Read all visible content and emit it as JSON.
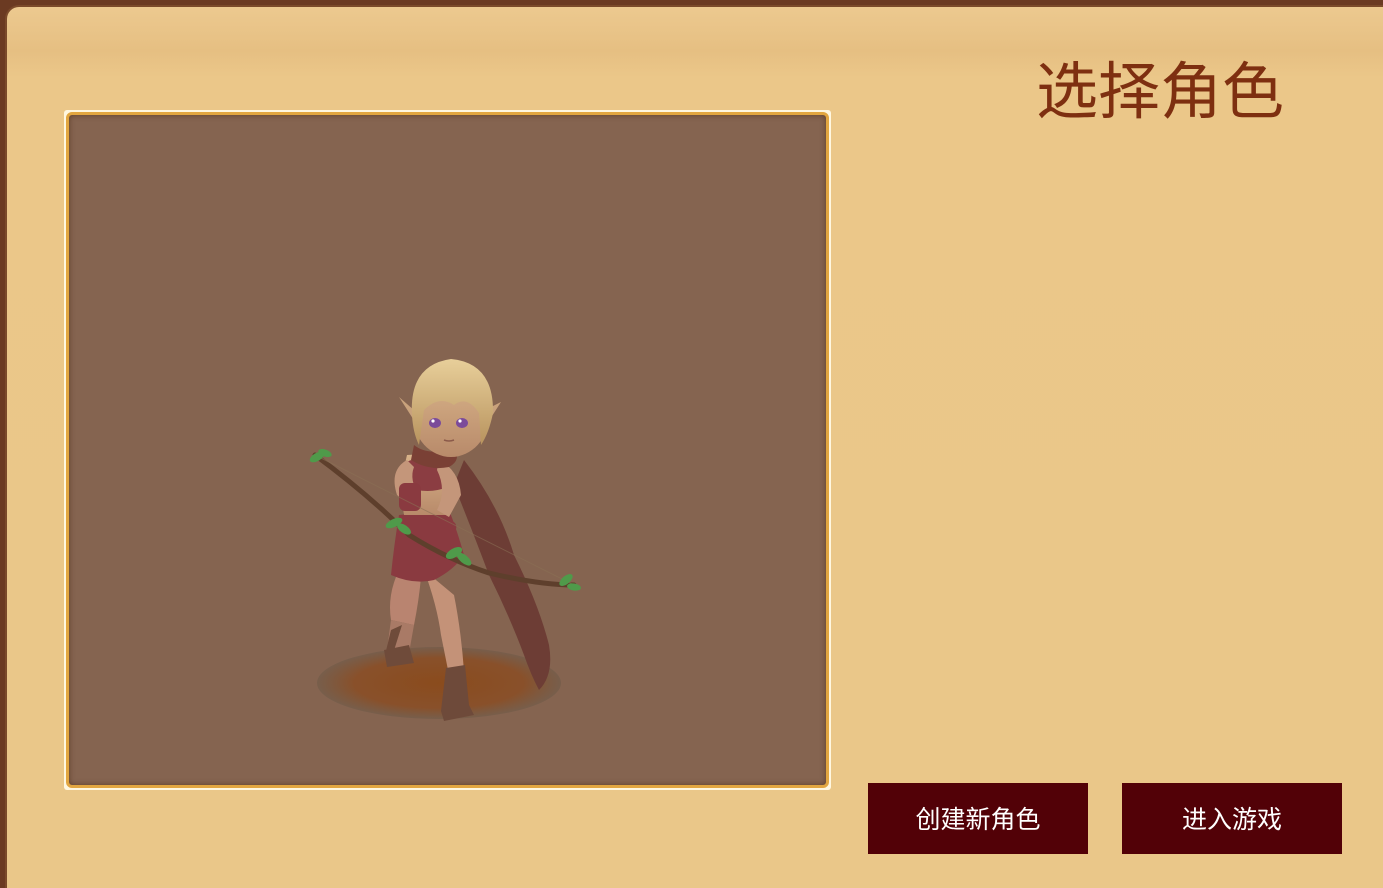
{
  "screen": {
    "title": "选择角色"
  },
  "character_preview": {
    "character": "elf-archer-character"
  },
  "actions": {
    "create_label": "创建新角色",
    "enter_label": "进入游戏"
  },
  "colors": {
    "panel_background": "#eac789",
    "title_color": "#7e2f10",
    "viewport_background": "#856450",
    "viewport_border": "#e2a640",
    "button_background": "#520107",
    "button_text": "#ffffff"
  }
}
